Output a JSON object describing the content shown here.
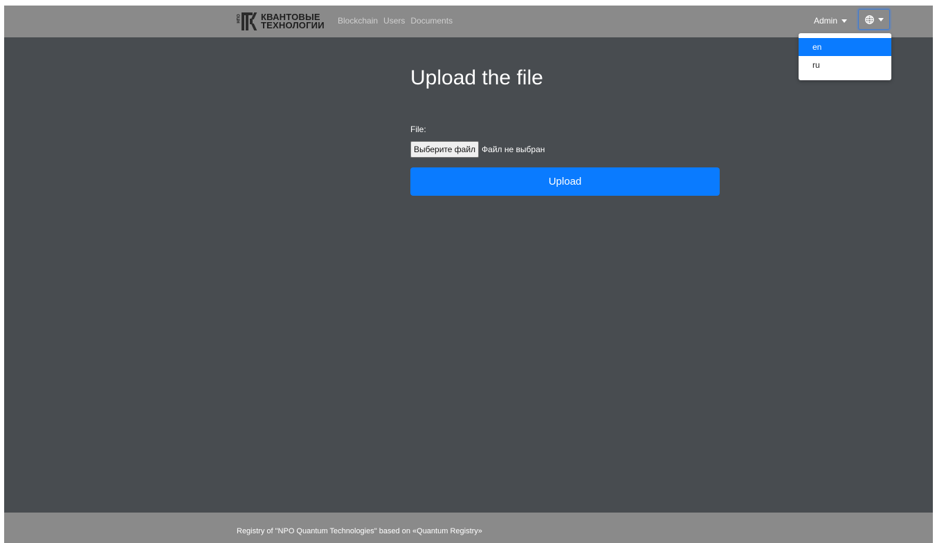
{
  "navbar": {
    "brand": {
      "line1": "КВАНТОВЫЕ",
      "line2": "ТЕХНОЛОГИИ",
      "vertical": "НПО"
    },
    "links": [
      "Blockchain",
      "Users",
      "Documents"
    ],
    "admin_label": "Admin",
    "lang_icon": "globe-icon"
  },
  "lang_menu": {
    "items": [
      "en",
      "ru"
    ],
    "active": "en"
  },
  "main": {
    "title": "Upload the file",
    "file_label": "File:",
    "choose_file_label": "Выберите файл",
    "no_file_text": "Файл не выбран",
    "upload_label": "Upload"
  },
  "footer": {
    "text": "Registry of \"NPO Quantum Technologies\" based on «Quantum Registry»"
  },
  "colors": {
    "background": "#484c50",
    "navbar": "#8a8a8a",
    "primary": "#0a7bff"
  }
}
